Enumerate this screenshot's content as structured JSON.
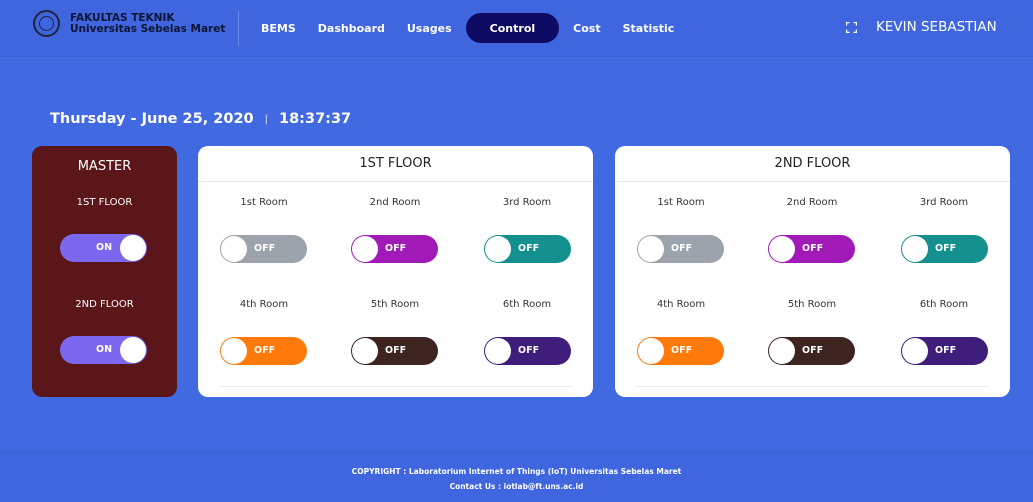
{
  "header": {
    "brand_line1": "FAKULTAS TEKNIK",
    "brand_line2": "Universitas Sebelas Maret",
    "nav": [
      "BEMS",
      "Dashboard",
      "Usages",
      "Control",
      "Cost",
      "Statistic"
    ],
    "active_nav": "Control",
    "user_name": "KEVIN SEBASTIAN"
  },
  "datetime": {
    "date": "Thursday - June 25, 2020",
    "separator": "|",
    "time": "18:37:37"
  },
  "master": {
    "title": "MASTER",
    "switches": [
      {
        "label": "1ST FLOOR",
        "state": "ON"
      },
      {
        "label": "2ND FLOOR",
        "state": "ON"
      }
    ],
    "on_color": "#7b68ee"
  },
  "floors": [
    {
      "title": "1ST FLOOR",
      "rooms": [
        {
          "name": "1st Room",
          "state": "OFF",
          "color": "#9ca3ab"
        },
        {
          "name": "2nd Room",
          "state": "OFF",
          "color": "#a11ab8"
        },
        {
          "name": "3rd Room",
          "state": "OFF",
          "color": "#14918f"
        },
        {
          "name": "4th Room",
          "state": "OFF",
          "color": "#ff7a0a"
        },
        {
          "name": "5th Room",
          "state": "OFF",
          "color": "#3d2420"
        },
        {
          "name": "6th Room",
          "state": "OFF",
          "color": "#3f1d7a"
        }
      ]
    },
    {
      "title": "2ND FLOOR",
      "rooms": [
        {
          "name": "1st Room",
          "state": "OFF",
          "color": "#9ca3ab"
        },
        {
          "name": "2nd Room",
          "state": "OFF",
          "color": "#a11ab8"
        },
        {
          "name": "3rd Room",
          "state": "OFF",
          "color": "#14918f"
        },
        {
          "name": "4th Room",
          "state": "OFF",
          "color": "#ff7a0a"
        },
        {
          "name": "5th Room",
          "state": "OFF",
          "color": "#3d2420"
        },
        {
          "name": "6th Room",
          "state": "OFF",
          "color": "#3f1d7a"
        }
      ]
    }
  ],
  "footer": {
    "copyright": "COPYRIGHT : Laboratorium Internet of Things (IoT) Universitas Sebelas Maret",
    "contact": "Contact Us : iotlab@ft.uns.ac.id"
  },
  "colors": {
    "background": "#4169e1",
    "active_nav": "#0e0b63",
    "master_card": "#5a1618"
  }
}
